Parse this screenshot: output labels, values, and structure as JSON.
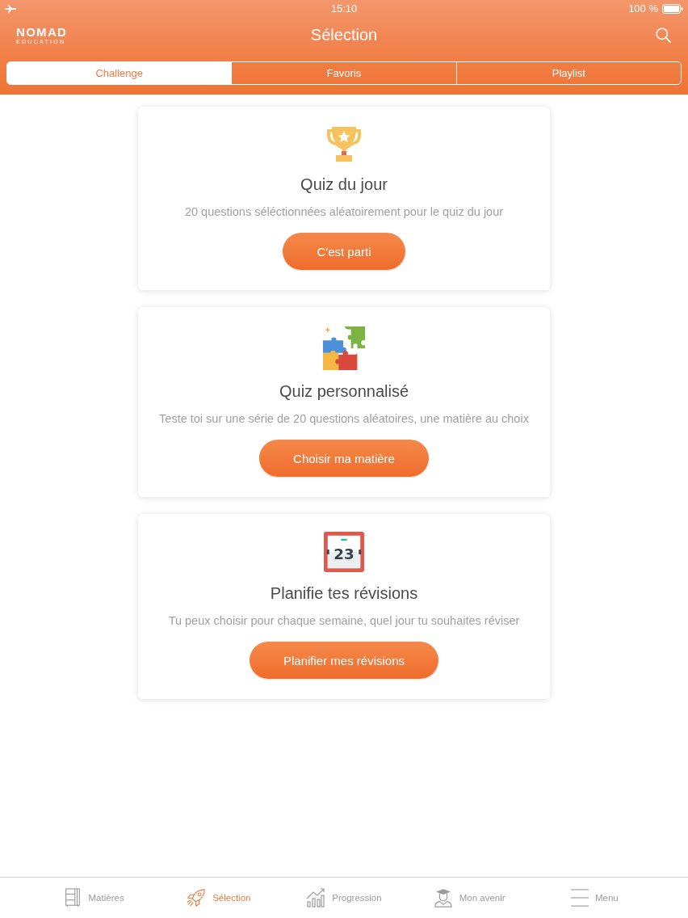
{
  "status_bar": {
    "time": "15:10",
    "battery": "100 %"
  },
  "header": {
    "logo": {
      "wordmark": "NOMAD",
      "tagline": "EDUCATION"
    },
    "title": "Sélection"
  },
  "segments": [
    {
      "label": "Challenge",
      "selected": true
    },
    {
      "label": "Favoris",
      "selected": false
    },
    {
      "label": "Playlist",
      "selected": false
    }
  ],
  "cards": [
    {
      "kind": "trophy",
      "title": "Quiz du jour",
      "description": "20 questions séléctionnées aléatoirement pour le quiz du jour",
      "button": "C'est parti"
    },
    {
      "kind": "puzzle",
      "title": "Quiz personnalisé",
      "description": "Teste toi sur une série de 20 questions aléatoires, une matière au choix",
      "button": "Choisir ma matière"
    },
    {
      "kind": "calendar",
      "date": "23",
      "title": "Planifie tes révisions",
      "description": "Tu peux choisir pour chaque semaine, quel jour tu souhaites réviser",
      "button": "Planifier mes révisions"
    }
  ],
  "tab_bar": [
    {
      "kind": "cabinet",
      "label": "Matières",
      "selected": false
    },
    {
      "kind": "rocket",
      "label": "Sélection",
      "selected": true
    },
    {
      "kind": "chart",
      "label": "Progression",
      "selected": false
    },
    {
      "kind": "graduate",
      "label": "Mon avenir",
      "selected": false
    },
    {
      "kind": "menu",
      "label": "Menu",
      "selected": false
    }
  ]
}
